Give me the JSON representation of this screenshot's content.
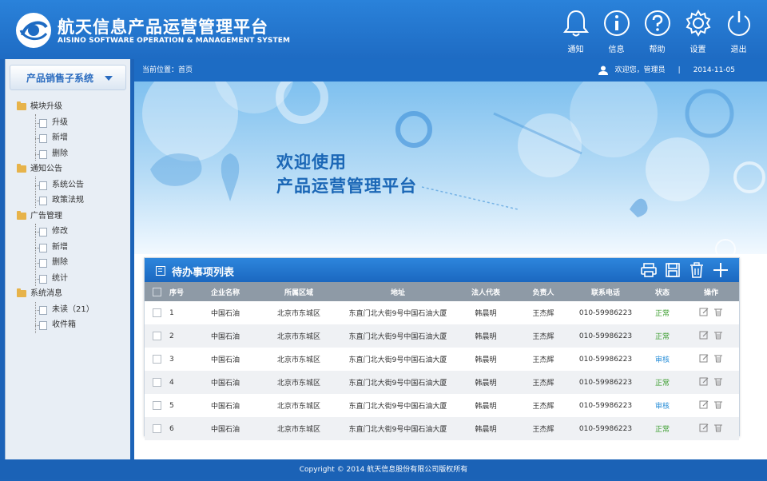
{
  "header": {
    "title_cn": "航天信息产品运营管理平台",
    "title_en": "AISINO SOFTWARE OPERATION & MANAGEMENT SYSTEM",
    "tools": [
      {
        "label": "通知",
        "icon": "bell-icon"
      },
      {
        "label": "信息",
        "icon": "info-icon"
      },
      {
        "label": "帮助",
        "icon": "help-icon"
      },
      {
        "label": "设置",
        "icon": "gear-icon"
      },
      {
        "label": "退出",
        "icon": "power-icon"
      }
    ]
  },
  "sidebar": {
    "title": "产品销售子系统",
    "groups": [
      {
        "label": "模块升级",
        "items": [
          "升级",
          "新增",
          "删除"
        ]
      },
      {
        "label": "通知公告",
        "items": [
          "系统公告",
          "政策法规"
        ]
      },
      {
        "label": "广告管理",
        "items": [
          "修改",
          "新增",
          "删除",
          "统计"
        ]
      },
      {
        "label": "系统消息",
        "items": [
          "未读（21）",
          "收件箱"
        ]
      }
    ]
  },
  "topbar": {
    "breadcrumb": "当前位置：首页",
    "welcome": "欢迎您，管理员",
    "separator": "|",
    "date": "2014-11-05"
  },
  "banner": {
    "line1": "欢迎使用",
    "line2": "产品运营管理平台"
  },
  "panel": {
    "title": "待办事项列表",
    "tools": [
      "print-icon",
      "save-icon",
      "trash-icon",
      "add-icon"
    ],
    "columns": [
      "序号",
      "企业名称",
      "所属区域",
      "地址",
      "法人代表",
      "负责人",
      "联系电话",
      "状态",
      "操作"
    ],
    "rows": [
      {
        "no": "1",
        "company": "中国石油",
        "region": "北京市东城区",
        "address": "东直门北大街9号中国石油大厦",
        "legal": "韩晨明",
        "owner": "王杰辉",
        "phone": "010-59986223",
        "status": "正常",
        "status_type": "normal"
      },
      {
        "no": "2",
        "company": "中国石油",
        "region": "北京市东城区",
        "address": "东直门北大街9号中国石油大厦",
        "legal": "韩晨明",
        "owner": "王杰辉",
        "phone": "010-59986223",
        "status": "正常",
        "status_type": "normal"
      },
      {
        "no": "3",
        "company": "中国石油",
        "region": "北京市东城区",
        "address": "东直门北大街9号中国石油大厦",
        "legal": "韩晨明",
        "owner": "王杰辉",
        "phone": "010-59986223",
        "status": "审核",
        "status_type": "review"
      },
      {
        "no": "4",
        "company": "中国石油",
        "region": "北京市东城区",
        "address": "东直门北大街9号中国石油大厦",
        "legal": "韩晨明",
        "owner": "王杰辉",
        "phone": "010-59986223",
        "status": "正常",
        "status_type": "normal"
      },
      {
        "no": "5",
        "company": "中国石油",
        "region": "北京市东城区",
        "address": "东直门北大街9号中国石油大厦",
        "legal": "韩晨明",
        "owner": "王杰辉",
        "phone": "010-59986223",
        "status": "审核",
        "status_type": "review"
      },
      {
        "no": "6",
        "company": "中国石油",
        "region": "北京市东城区",
        "address": "东直门北大街9号中国石油大厦",
        "legal": "韩晨明",
        "owner": "王杰辉",
        "phone": "010-59986223",
        "status": "正常",
        "status_type": "normal"
      }
    ]
  },
  "footer": {
    "copyright": "Copyright © 2014 航天信息股份有限公司版权所有"
  },
  "colors": {
    "header_blue": "#1e6bc3",
    "status_normal": "#3b9d2e",
    "status_review": "#2a8fd8"
  }
}
